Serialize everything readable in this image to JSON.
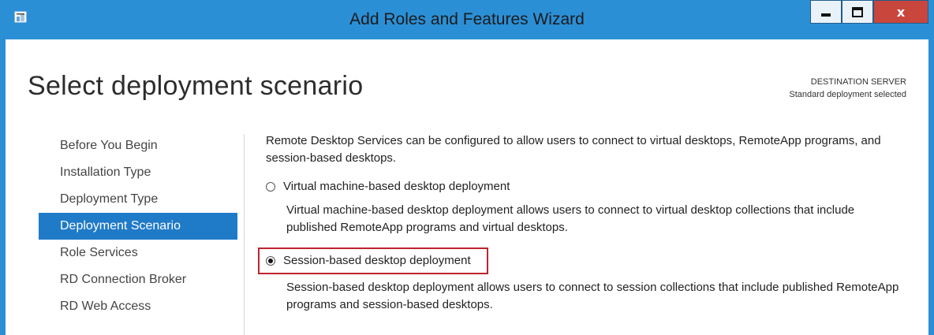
{
  "window": {
    "title": "Add Roles and Features Wizard",
    "accent_color": "#2b8fd6",
    "close_color": "#c9463d",
    "controls": {
      "minimize_icon": "minimize-icon",
      "maximize_icon": "maximize-icon",
      "close_label": "x"
    }
  },
  "page": {
    "title": "Select deployment scenario",
    "destination_label": "DESTINATION SERVER",
    "destination_value": "Standard deployment selected"
  },
  "nav": {
    "items": [
      {
        "label": "Before You Begin",
        "active": false
      },
      {
        "label": "Installation Type",
        "active": false
      },
      {
        "label": "Deployment Type",
        "active": false
      },
      {
        "label": "Deployment Scenario",
        "active": true
      },
      {
        "label": "Role Services",
        "active": false
      },
      {
        "label": "RD Connection Broker",
        "active": false
      },
      {
        "label": "RD Web Access",
        "active": false
      }
    ],
    "active_color": "#1f7ac8"
  },
  "content": {
    "intro": "Remote Desktop Services can be configured to allow users to connect to virtual desktops, RemoteApp programs, and session-based desktops.",
    "options": [
      {
        "label": "Virtual machine-based desktop deployment",
        "selected": false,
        "description": "Virtual machine-based desktop deployment allows users to connect to virtual desktop collections that include published RemoteApp programs and virtual desktops."
      },
      {
        "label": "Session-based desktop deployment",
        "selected": true,
        "description": "Session-based desktop deployment allows users to connect to session collections that include published RemoteApp programs and session-based desktops."
      }
    ],
    "highlight_color": "#c0232f"
  }
}
